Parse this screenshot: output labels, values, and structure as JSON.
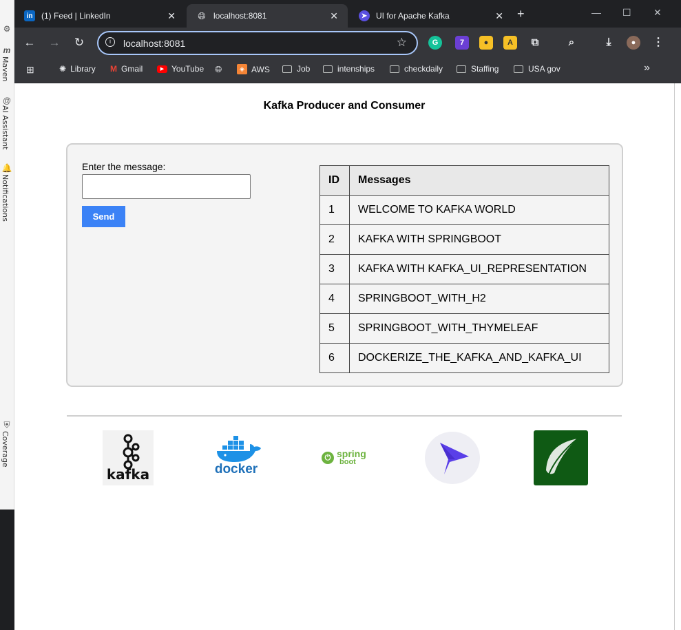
{
  "ide": {
    "panels": [
      "Maven",
      "AI Assistant",
      "Notifications",
      "Coverage"
    ]
  },
  "browser": {
    "tabs": [
      {
        "title": "(1) Feed | LinkedIn",
        "icon": "linkedin-icon",
        "active": false
      },
      {
        "title": "localhost:8081",
        "icon": "globe-icon",
        "active": true
      },
      {
        "title": "UI for Apache Kafka",
        "icon": "kafka-ui-icon",
        "active": false
      }
    ],
    "url": "localhost:8081",
    "bookmarks": [
      {
        "label": "Library",
        "icon": "openai-icon"
      },
      {
        "label": "Gmail",
        "icon": "gmail-icon"
      },
      {
        "label": "YouTube",
        "icon": "youtube-icon"
      },
      {
        "label": "",
        "icon": "globe-icon"
      },
      {
        "label": "AWS",
        "icon": "aws-icon"
      },
      {
        "label": "Job",
        "icon": "folder-icon"
      },
      {
        "label": "intenships",
        "icon": "folder-icon"
      },
      {
        "label": "checkdaily",
        "icon": "folder-icon"
      },
      {
        "label": "Staffing",
        "icon": "folder-icon"
      },
      {
        "label": "USA gov",
        "icon": "folder-icon"
      }
    ],
    "extension_badge": "7"
  },
  "page": {
    "title": "Kafka Producer and Consumer",
    "form": {
      "label": "Enter the message:",
      "value": "",
      "send_label": "Send"
    },
    "table": {
      "headers": [
        "ID",
        "Messages"
      ],
      "rows": [
        [
          "1",
          "WELCOME TO KAFKA WORLD"
        ],
        [
          "2",
          "KAFKA WITH SPRINGBOOT"
        ],
        [
          "3",
          "KAFKA WITH KAFKA_UI_REPRESENTATION"
        ],
        [
          "4",
          "SPRINGBOOT_WITH_H2"
        ],
        [
          "5",
          "SPRINGBOOT_WITH_THYMELEAF"
        ],
        [
          "6",
          "DOCKERIZE_THE_KAFKA_AND_KAFKA_UI"
        ]
      ]
    },
    "logos": [
      {
        "name": "kafka-logo",
        "text": "kafka"
      },
      {
        "name": "docker-logo",
        "text": "docker"
      },
      {
        "name": "spring-boot-logo",
        "text": "spring",
        "subtext": "boot"
      },
      {
        "name": "kafka-ui-logo",
        "text": ""
      },
      {
        "name": "thymeleaf-logo",
        "text": ""
      }
    ]
  }
}
